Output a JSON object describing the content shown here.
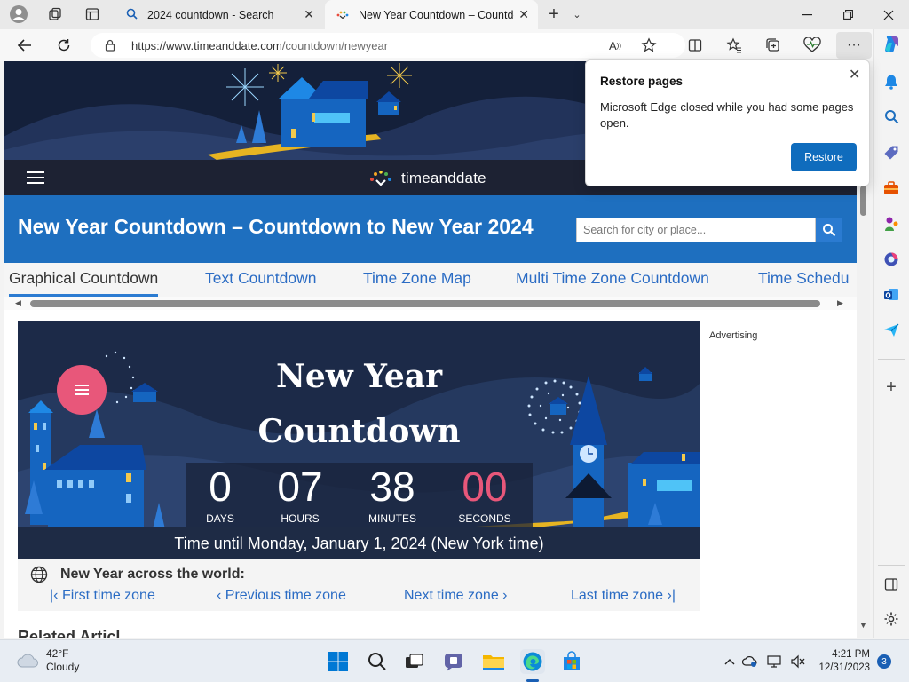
{
  "browser": {
    "tabs": [
      {
        "title": "2024 countdown - Search",
        "icon": "search-icon"
      },
      {
        "title": "New Year Countdown – Countdo",
        "icon": "timeanddate-icon"
      }
    ],
    "url_domain": "https://www.timeanddate.com",
    "url_path": "/countdown/newyear"
  },
  "site": {
    "logo_text": "timeanddate",
    "page_title": "New Year Countdown – Countdown to New Year 2024",
    "search_placeholder": "Search for city or place...",
    "tabs": [
      "Graphical Countdown",
      "Text Countdown",
      "Time Zone Map",
      "Multi Time Zone Countdown",
      "Time Schedu"
    ]
  },
  "countdown": {
    "title_line1": "New Year",
    "title_line2": "Countdown",
    "units": [
      {
        "value": "0",
        "label": "DAYS"
      },
      {
        "value": "07",
        "label": "HOURS"
      },
      {
        "value": "38",
        "label": "MINUTES"
      },
      {
        "value": "00",
        "label": "SECONDS"
      }
    ],
    "until_text": "Time until Monday, January 1, 2024 (New York time)"
  },
  "world": {
    "heading": "New Year across the world:",
    "first": "First time zone",
    "previous": "Previous time zone",
    "next": "Next time zone",
    "last": "Last time zone"
  },
  "advert_label": "Advertising",
  "related_heading": "Related Articl",
  "popup": {
    "title": "Restore pages",
    "message": "Microsoft Edge closed while you had some pages open.",
    "button": "Restore"
  },
  "taskbar": {
    "temperature": "42°F",
    "condition": "Cloudy",
    "time": "4:21 PM",
    "date": "12/31/2023",
    "notification_count": "3"
  },
  "colors": {
    "accent_blue": "#1e6fbf",
    "countdown_bg": "#1c2a48",
    "seconds_pink": "#e8577a",
    "edge_button": "#0f6cbd"
  }
}
